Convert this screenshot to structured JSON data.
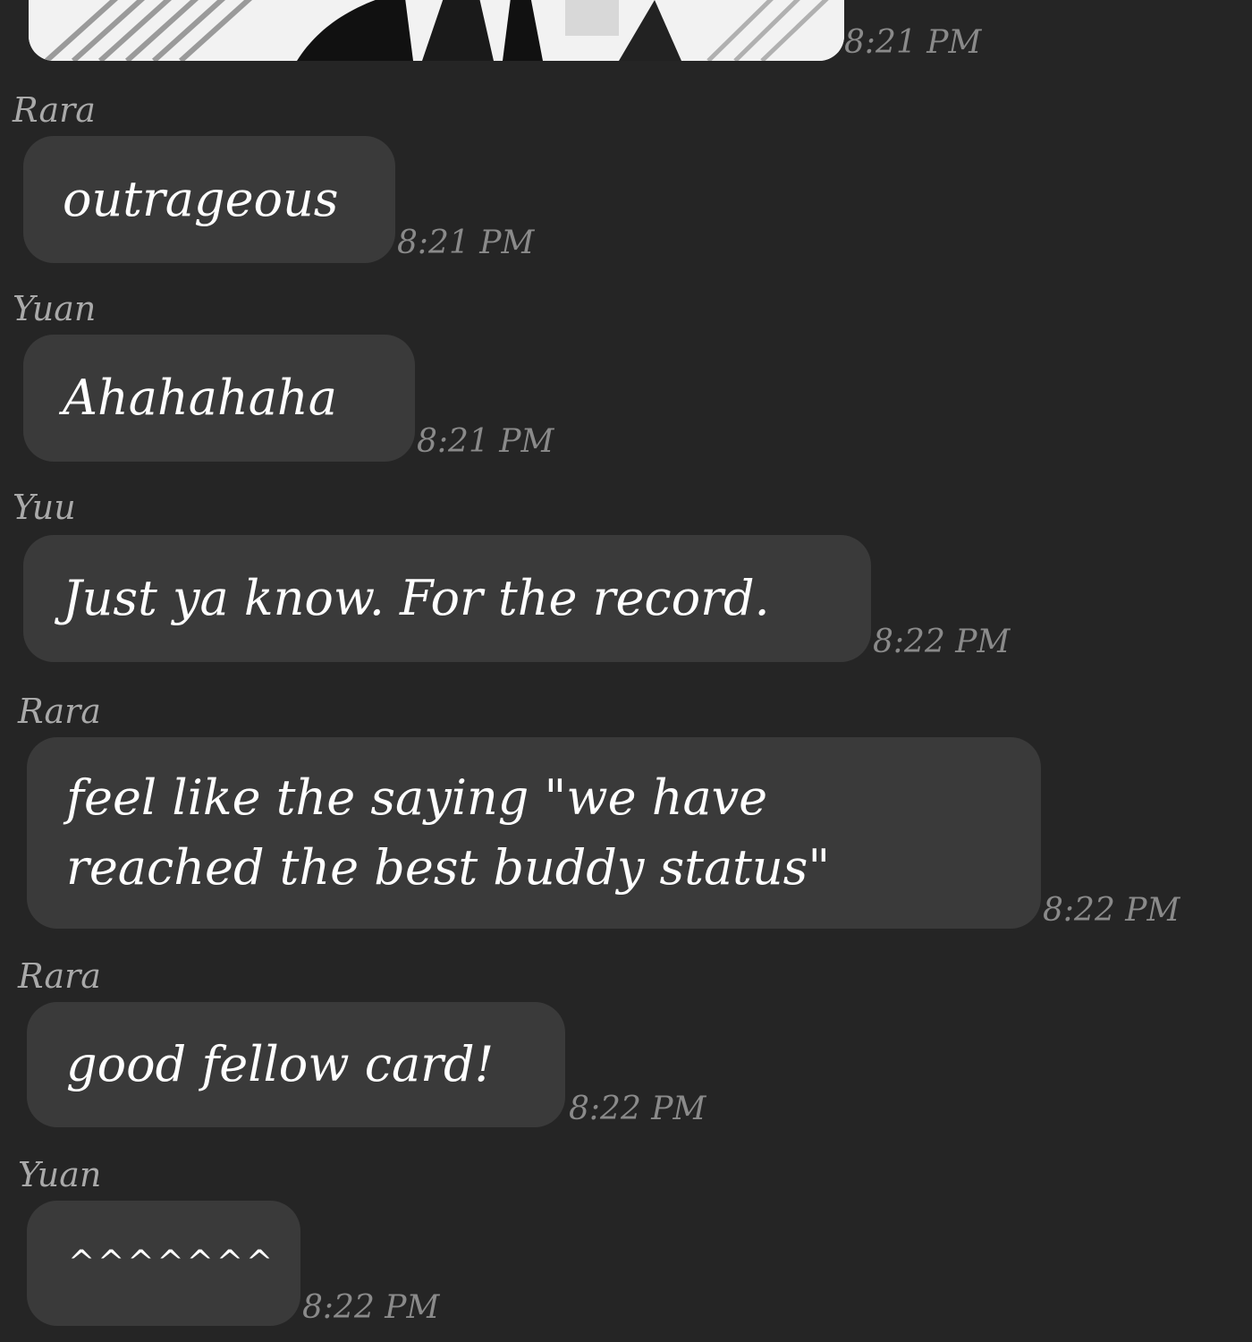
{
  "conversation": {
    "top_image": {
      "timestamp": "8:21 PM"
    },
    "messages": [
      {
        "sender": "Rara",
        "text": "outrageous",
        "timestamp": "8:21 PM"
      },
      {
        "sender": "Yuan",
        "text": "Ahahahaha",
        "timestamp": "8:21 PM"
      },
      {
        "sender": "Yuu",
        "text": "Just ya know. For the record.",
        "timestamp": "8:22 PM"
      },
      {
        "sender": "Rara",
        "text": "feel like the saying \"we have\nreached the best buddy status\"",
        "timestamp": "8:22 PM"
      },
      {
        "sender": "Rara",
        "text": "good fellow card!",
        "timestamp": "8:22 PM"
      },
      {
        "sender": "Yuan",
        "text": "^^^^^^^",
        "timestamp": "8:22 PM"
      }
    ]
  },
  "colors": {
    "background": "#252525",
    "bubble": "#3a3a3a",
    "sender": "#a9a9a9",
    "timestamp": "#8a8a8a",
    "text": "#ffffff"
  }
}
